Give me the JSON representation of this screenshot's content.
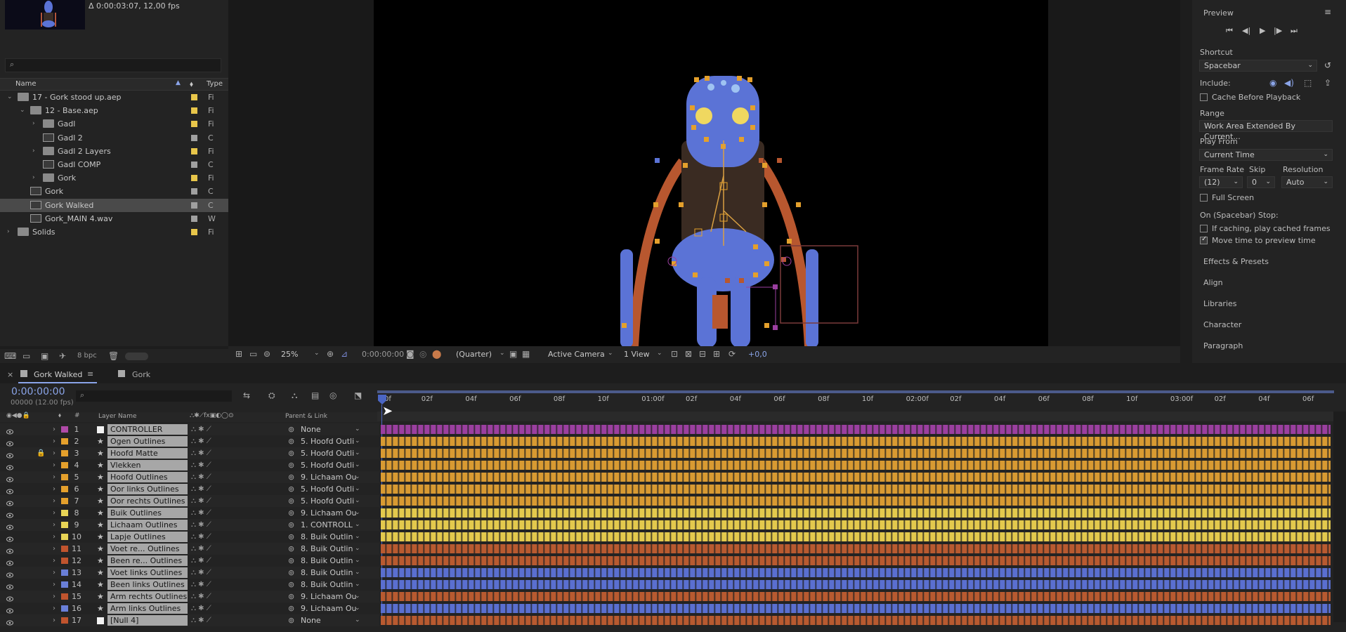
{
  "project": {
    "thumb_info": "Δ 0:00:03:07, 12,00 fps",
    "col_name": "Name",
    "col_type": "Type",
    "bpc": "8 bpc",
    "items": [
      {
        "name": "17 - Gork stood up.aep",
        "type": "Fi",
        "kind": "folder",
        "indent": 0,
        "twirl": "⌄",
        "label": "#e8c64a"
      },
      {
        "name": "12 - Base.aep",
        "type": "Fi",
        "kind": "folder",
        "indent": 1,
        "twirl": "⌄",
        "label": "#e8c64a"
      },
      {
        "name": "Gadl",
        "type": "Fi",
        "kind": "folder",
        "indent": 2,
        "twirl": "›",
        "label": "#e8c64a"
      },
      {
        "name": "Gadl 2",
        "type": "C",
        "kind": "comp",
        "indent": 2,
        "twirl": "",
        "label": "#a0a0a0"
      },
      {
        "name": "Gadl 2 Layers",
        "type": "Fi",
        "kind": "folder",
        "indent": 2,
        "twirl": "›",
        "label": "#e8c64a"
      },
      {
        "name": "Gadl COMP",
        "type": "C",
        "kind": "comp",
        "indent": 2,
        "twirl": "",
        "label": "#a0a0a0"
      },
      {
        "name": "Gork",
        "type": "Fi",
        "kind": "folder",
        "indent": 2,
        "twirl": "›",
        "label": "#e8c64a"
      },
      {
        "name": "Gork",
        "type": "C",
        "kind": "comp",
        "indent": 1,
        "twirl": "",
        "label": "#a0a0a0"
      },
      {
        "name": "Gork Walked",
        "type": "C",
        "kind": "comp",
        "indent": 1,
        "twirl": "",
        "label": "#a0a0a0",
        "selected": true
      },
      {
        "name": "Gork_MAIN 4.wav",
        "type": "W",
        "kind": "audio",
        "indent": 1,
        "twirl": "",
        "label": "#a0a0a0"
      },
      {
        "name": "Solids",
        "type": "Fi",
        "kind": "folder",
        "indent": 0,
        "twirl": "›",
        "label": "#e8c64a"
      }
    ]
  },
  "viewer": {
    "zoom": "25%",
    "timecode": "0:00:00:00",
    "resolution": "(Quarter)",
    "camera": "Active Camera",
    "view": "1 View",
    "exposure": "+0,0"
  },
  "preview": {
    "title": "Preview",
    "shortcut_label": "Shortcut",
    "shortcut_value": "Spacebar",
    "include_label": "Include:",
    "cache_before": "Cache Before Playback",
    "range_label": "Range",
    "range_value": "Work Area Extended By Current...",
    "play_from_label": "Play From",
    "play_from_value": "Current Time",
    "frame_rate_label": "Frame Rate",
    "skip_label": "Skip",
    "resolution_label": "Resolution",
    "frame_rate_value": "(12)",
    "skip_value": "0",
    "resolution_value": "Auto",
    "full_screen": "Full Screen",
    "stop_label": "On (Spacebar) Stop:",
    "if_caching": "If caching, play cached frames",
    "move_time": "Move time to preview time"
  },
  "panels": [
    "Effects & Presets",
    "Align",
    "Libraries",
    "Character",
    "Paragraph"
  ],
  "timeline": {
    "tab_active": "Gork Walked",
    "tab_other": "Gork",
    "timecode": "0:00:00:00",
    "frames_fps": "00000 (12.00 fps)",
    "col_layer_name": "Layer Name",
    "col_parent": "Parent & Link",
    "ruler": [
      "0f",
      "02f",
      "04f",
      "06f",
      "08f",
      "10f",
      "01:00f",
      "02f",
      "04f",
      "06f",
      "08f",
      "10f",
      "02:00f",
      "02f",
      "04f",
      "06f",
      "08f",
      "10f",
      "03:00f",
      "02f",
      "04f",
      "06f"
    ],
    "layers": [
      {
        "num": "1",
        "name": "CONTROLLER",
        "parent": "None",
        "label": "#b04aa8",
        "bar": "#9b3fa0",
        "icon": "solid-white",
        "locked": false
      },
      {
        "num": "2",
        "name": "Ogen Outlines",
        "parent": "5. Hoofd Outli",
        "label": "#e4a02c",
        "bar": "#d89a32",
        "icon": "star",
        "locked": false
      },
      {
        "num": "3",
        "name": "Hoofd Matte",
        "parent": "5. Hoofd Outli",
        "label": "#e4a02c",
        "bar": "#d89a32",
        "icon": "star",
        "locked": true
      },
      {
        "num": "4",
        "name": "Vlekken",
        "parent": "5. Hoofd Outli",
        "label": "#e4a02c",
        "bar": "#d89a32",
        "icon": "star",
        "locked": false
      },
      {
        "num": "5",
        "name": "Hoofd Outlines",
        "parent": "9. Lichaam Ou",
        "label": "#e4a02c",
        "bar": "#d89a32",
        "icon": "star",
        "locked": false
      },
      {
        "num": "6",
        "name": "Oor links Outlines",
        "parent": "5. Hoofd Outli",
        "label": "#e4a02c",
        "bar": "#d89a32",
        "icon": "star",
        "locked": false
      },
      {
        "num": "7",
        "name": "Oor rechts Outlines",
        "parent": "5. Hoofd Outli",
        "label": "#e4a02c",
        "bar": "#d89a32",
        "icon": "star",
        "locked": false
      },
      {
        "num": "8",
        "name": "Buik Outlines",
        "parent": "9. Lichaam Ou",
        "label": "#e8d456",
        "bar": "#e3c94d",
        "icon": "star",
        "locked": false
      },
      {
        "num": "9",
        "name": "Lichaam Outlines",
        "parent": "1. CONTROLL",
        "label": "#e8d456",
        "bar": "#e3c94d",
        "icon": "star",
        "locked": false
      },
      {
        "num": "10",
        "name": "Lapje Outlines",
        "parent": "8. Buik Outlin",
        "label": "#e8d456",
        "bar": "#e3c94d",
        "icon": "star",
        "locked": false
      },
      {
        "num": "11",
        "name": "Voet re... Outlines",
        "parent": "8. Buik Outlin",
        "label": "#c0542e",
        "bar": "#b85a30",
        "icon": "star",
        "locked": false
      },
      {
        "num": "12",
        "name": "Been re... Outlines",
        "parent": "8. Buik Outlin",
        "label": "#c0542e",
        "bar": "#b85a30",
        "icon": "star",
        "locked": false
      },
      {
        "num": "13",
        "name": "Voet links Outlines",
        "parent": "8. Buik Outlin",
        "label": "#6a7fd8",
        "bar": "#5a6fd0",
        "icon": "star",
        "locked": false
      },
      {
        "num": "14",
        "name": "Been links Outlines",
        "parent": "8. Buik Outlin",
        "label": "#6a7fd8",
        "bar": "#5a6fd0",
        "icon": "star",
        "locked": false
      },
      {
        "num": "15",
        "name": "Arm rechts Outlines",
        "parent": "9. Lichaam Ou",
        "label": "#c0542e",
        "bar": "#b85a30",
        "icon": "star",
        "locked": false
      },
      {
        "num": "16",
        "name": "Arm links Outlines",
        "parent": "9. Lichaam Ou",
        "label": "#6a7fd8",
        "bar": "#5a6fd0",
        "icon": "star",
        "locked": false
      },
      {
        "num": "17",
        "name": "[Null 4]",
        "parent": "None",
        "label": "#c0542e",
        "bar": "#b85a30",
        "icon": "null-white",
        "locked": false
      }
    ]
  }
}
